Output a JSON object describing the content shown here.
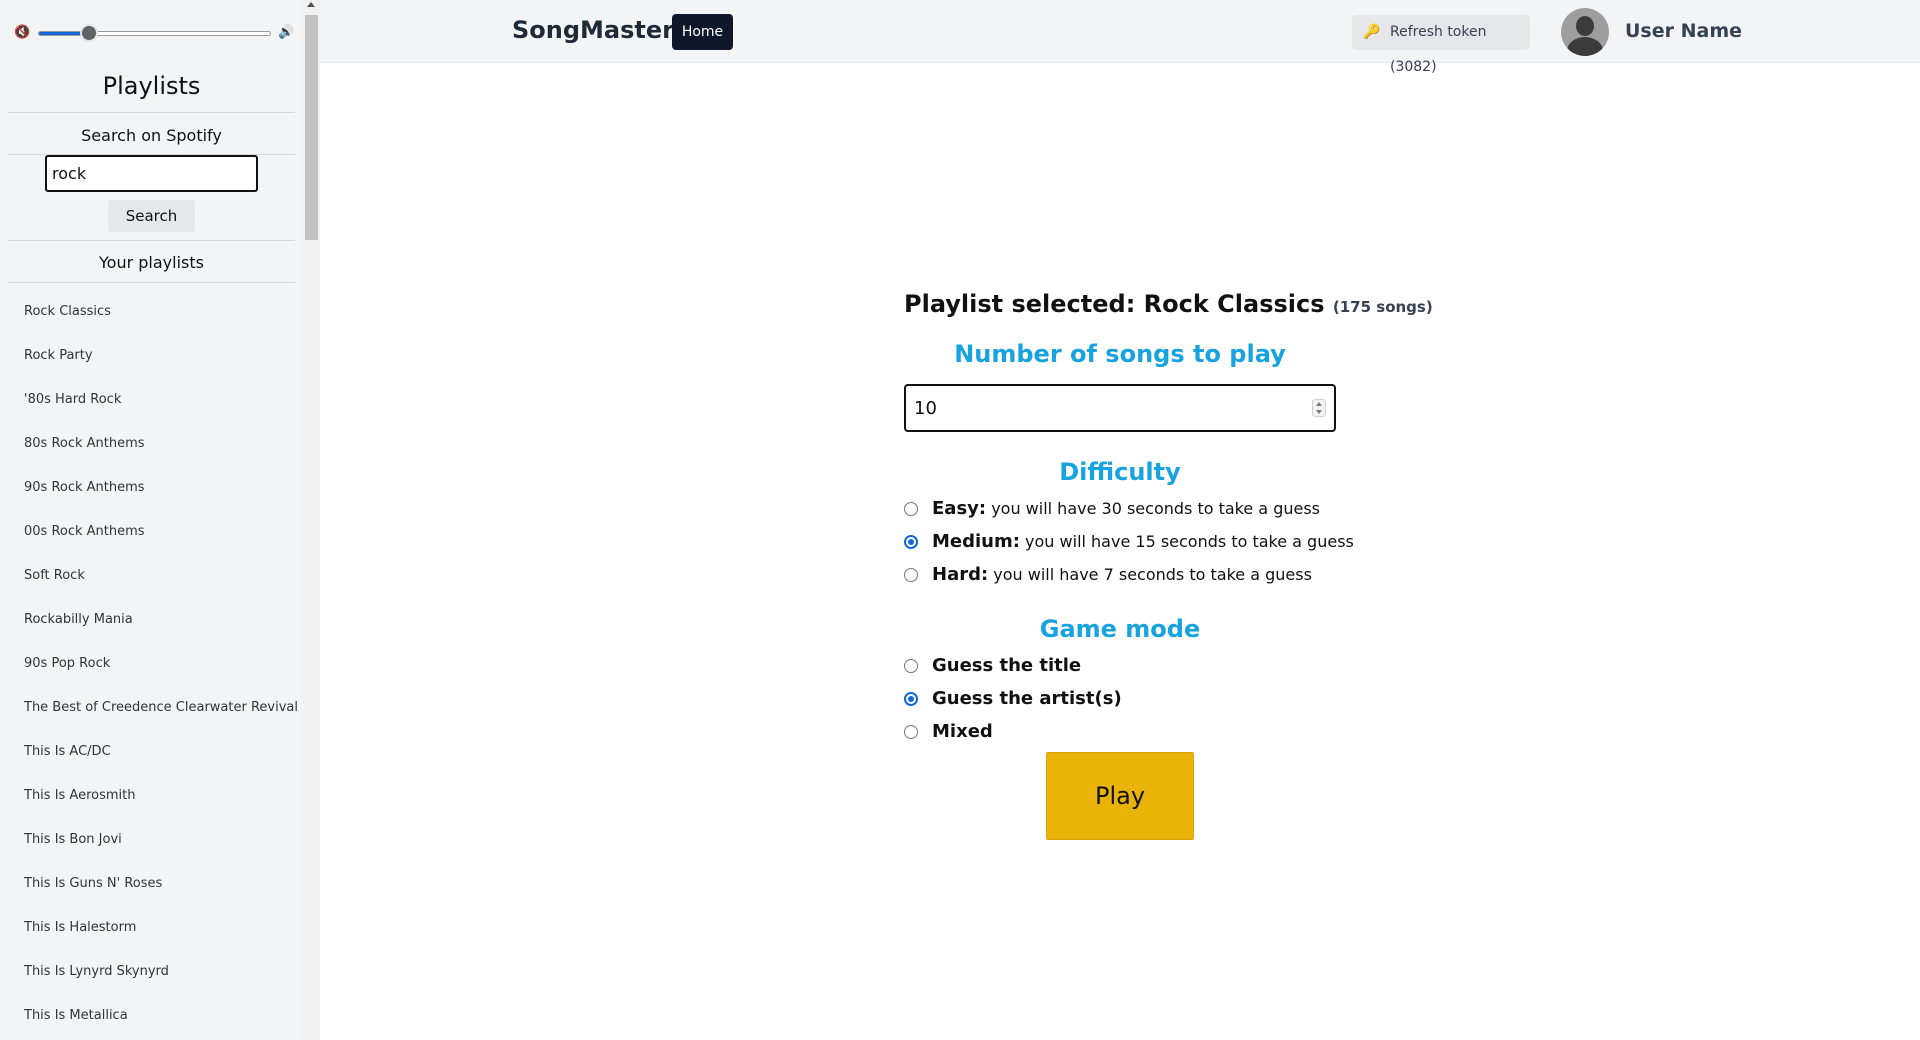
{
  "volume": {
    "level_percent": 22,
    "mute_icon": "speaker-mute-icon",
    "loud_icon": "speaker-loud-icon"
  },
  "sidebar": {
    "title": "Playlists",
    "search_heading": "Search on Spotify",
    "search_value": "rock",
    "search_button": "Search",
    "your_playlists": "Your playlists",
    "items": [
      "Rock Classics",
      "Rock Party",
      "'80s Hard Rock",
      "80s Rock Anthems",
      "90s Rock Anthems",
      "00s Rock Anthems",
      "Soft Rock",
      "Rockabilly Mania",
      "90s Pop Rock",
      "The Best of Creedence Clearwater Revival",
      "This Is AC/DC",
      "This Is Aerosmith",
      "This Is Bon Jovi",
      "This Is Guns N' Roses",
      "This Is Halestorm",
      "This Is Lynyrd Skynyrd",
      "This Is Metallica"
    ]
  },
  "header": {
    "brand": "SongMaster",
    "home": "Home",
    "refresh": "Refresh token (3082)",
    "username": "User Name"
  },
  "main": {
    "playlist_label": "Playlist selected: Rock Classics",
    "playlist_count": "(175 songs)",
    "songs_title": "Number of songs to play",
    "songs_value": "10",
    "difficulty_title": "Difficulty",
    "difficulty": [
      {
        "label": "Easy:",
        "desc": "you will have 30 seconds to take a guess",
        "selected": false
      },
      {
        "label": "Medium:",
        "desc": "you will have 15 seconds to take a guess",
        "selected": true
      },
      {
        "label": "Hard:",
        "desc": "you will have 7 seconds to take a guess",
        "selected": false
      }
    ],
    "mode_title": "Game mode",
    "modes": [
      {
        "label": "Guess the title",
        "selected": false
      },
      {
        "label": "Guess the artist(s)",
        "selected": true
      },
      {
        "label": "Mixed",
        "selected": false
      }
    ],
    "play": "Play"
  },
  "colors": {
    "accent": "#17a2e0",
    "play": "#eab308",
    "home_bg": "#0f172a",
    "radio_selected": "#1565d8"
  }
}
